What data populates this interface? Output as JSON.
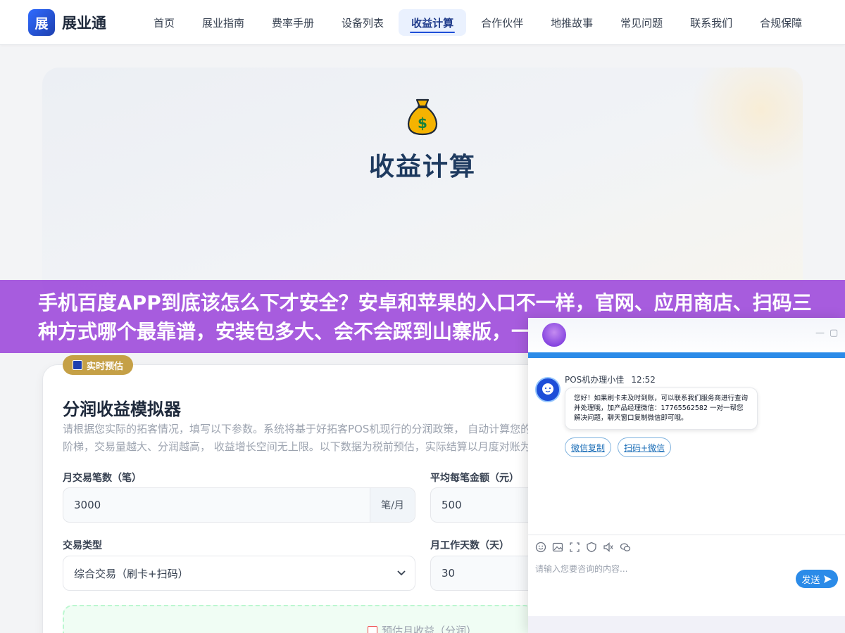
{
  "header": {
    "logo_mark": "展",
    "logo_text": "展业通",
    "nav": [
      {
        "label": "首页"
      },
      {
        "label": "展业指南"
      },
      {
        "label": "费率手册"
      },
      {
        "label": "设备列表"
      },
      {
        "label": "收益计算",
        "active": true
      },
      {
        "label": "合作伙伴"
      },
      {
        "label": "地推故事"
      },
      {
        "label": "常见问题"
      },
      {
        "label": "联系我们"
      },
      {
        "label": "合规保障"
      }
    ]
  },
  "hero": {
    "icon": "money-bag-icon",
    "title": "收益计算"
  },
  "banner": {
    "text": "手机百度APP到底该怎么下才安全？安卓和苹果的入口不一样，官网、应用商店、扫码三种方式哪个最靠谱，安装包多大、会不会踩到山寨版，一"
  },
  "calculator": {
    "badge": "实时预估",
    "title": "分润收益模拟器",
    "desc": "请根据您实际的拓客情况，填写以下参数。系统将基于好拓客POS机现行的分润政策， 自动计算您的阶梯，交易量越大、分润越高， 收益增长空间无上限。以下数据为税前预估，实际结算以月度对账为",
    "fields": {
      "monthly_count": {
        "label": "月交易笔数（笔）",
        "value": "3000",
        "unit": "笔/月"
      },
      "avg_amount": {
        "label": "平均每笔金额（元）",
        "value": "500"
      },
      "txn_type": {
        "label": "交易类型",
        "value": "综合交易（刷卡+扫码）"
      },
      "work_days": {
        "label": "月工作天数（天）",
        "value": "30"
      }
    },
    "result_label": "预估月收益（分润）"
  },
  "chat": {
    "agent_name": "POS机办理小佳",
    "time": "12:52",
    "message": "您好！如果刷卡未及时到账，可以联系我们服务商进行查询并处理哦，加产品经理微信：17765562582 一对一帮您解决问题，聊天窗口复制微信即可哦。",
    "chips": [
      "微信复制",
      "扫码+微信"
    ],
    "input_placeholder": "请输入您要咨询的内容...",
    "send_label": "发送",
    "header_controls": [
      "—",
      "▢"
    ]
  },
  "colors": {
    "accent": "#1d4ed8",
    "banner": "#a050dc",
    "badge": "#c5a046",
    "chat_blue": "#2b8be8"
  }
}
